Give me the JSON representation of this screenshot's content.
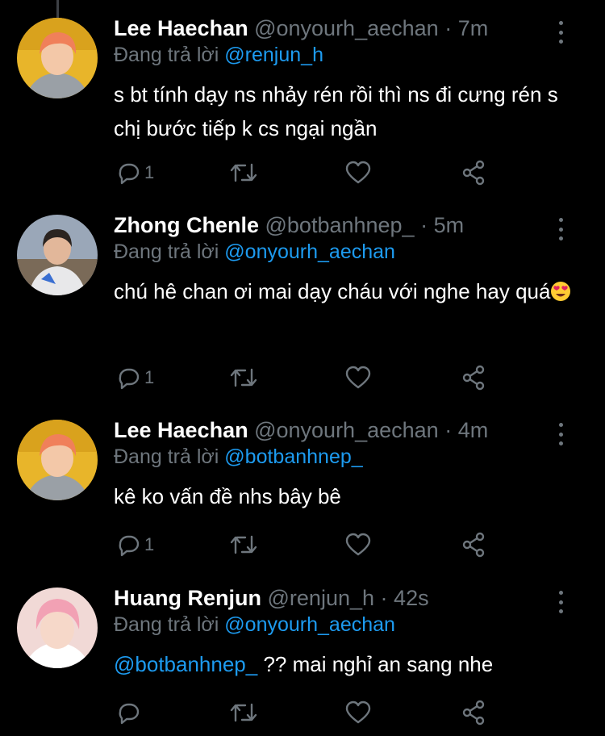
{
  "tweets": [
    {
      "name": "Lee Haechan",
      "handle": "@onyourh_aechan",
      "sep": "·",
      "time": "7m",
      "replying_prefix": "Đang trả lời",
      "replying_to": "@renjun_h",
      "body": "s bt tính dạy ns nhảy rén rồi thì ns đi cưng rén s chị bước tiếp k cs ngại ngần",
      "reply_count": "1",
      "avatar_colors": {
        "bg": "#e8b52a",
        "hair": "#f0805a",
        "face": "#f3c8a8",
        "shirt": "#9aa0a6"
      }
    },
    {
      "name": "Zhong Chenle",
      "handle": "@botbanhnep_",
      "sep": "·",
      "time": "5m",
      "replying_prefix": "Đang trả lời",
      "replying_to": "@onyourh_aechan",
      "body": "chú hê chan ơi mai dạy cháu với nghe hay quá",
      "body_emoji": "heart-eyes-emoji",
      "reply_count": "1",
      "avatar_colors": {
        "bg": "#9aa7b8",
        "hair": "#2b2420",
        "face": "#e2b79a",
        "shirt": "#e8e8ea"
      }
    },
    {
      "name": "Lee Haechan",
      "handle": "@onyourh_aechan",
      "sep": "·",
      "time": "4m",
      "replying_prefix": "Đang trả lời",
      "replying_to": "@botbanhnep_",
      "body": "kê ko vấn đề nhs bây bê",
      "reply_count": "1",
      "avatar_colors": {
        "bg": "#e8b52a",
        "hair": "#f0805a",
        "face": "#f3c8a8",
        "shirt": "#9aa0a6"
      }
    },
    {
      "name": "Huang Renjun",
      "handle": "@renjun_h",
      "sep": "·",
      "time": "42s",
      "replying_prefix": "Đang trả lời",
      "replying_to": "@onyourh_aechan",
      "body_mention": "@botbanhnep_",
      "body": "?? mai nghỉ an sang nhe",
      "reply_count": "",
      "avatar_colors": {
        "bg": "#f1d9d6",
        "hair": "#f2a1b4",
        "face": "#f6d8c9",
        "shirt": "#ffffff"
      }
    }
  ],
  "icons": [
    "reply-icon",
    "retweet-icon",
    "like-icon",
    "share-icon",
    "more-icon"
  ],
  "colors": {
    "background": "#000000",
    "text": "#ffffff",
    "muted": "#6e767d",
    "link": "#1d9bf0"
  }
}
